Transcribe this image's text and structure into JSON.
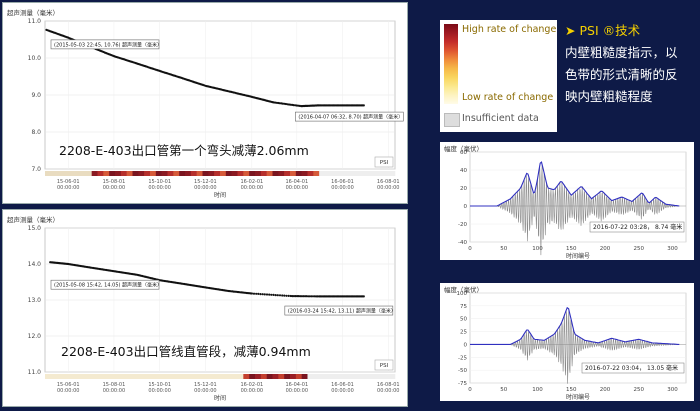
{
  "chart_data": [
    {
      "type": "scatter",
      "ylabel": "超声测量（毫米）",
      "xlabel": "时间",
      "ylim": [
        7.0,
        11.0
      ],
      "yticks": [
        "11.0",
        "10.0",
        "9.0",
        "8.0",
        "7.0"
      ],
      "xticks": [
        "15-06-01\n00:00:00",
        "15-08-01\n00:00:00",
        "15-10-01\n00:00:00",
        "15-12-01\n00:00:00",
        "16-02-01\n00:00:00",
        "16-04-01\n00:00:00",
        "16-06-01\n00:00:00",
        "16-08-01\n00:00:00"
      ],
      "annotations": [
        "(2015-05-03 22:45, 10.76) 超声测量（毫米）",
        "(2016-04-07 06:32, 8.70) 超声测量（毫米）"
      ],
      "caption": "2208-E-403出口管第一个弯头减薄2.06mm",
      "badge": "PSI",
      "x": [
        "2015-05-03",
        "2015-06-01",
        "2015-07-01",
        "2015-08-01",
        "2015-09-01",
        "2015-10-01",
        "2015-11-01",
        "2015-12-01",
        "2016-01-01",
        "2016-02-01",
        "2016-03-01",
        "2016-04-07",
        "2016-05-01",
        "2016-06-01",
        "2016-07-01"
      ],
      "y": [
        10.76,
        10.55,
        10.3,
        10.05,
        9.85,
        9.65,
        9.45,
        9.25,
        9.1,
        8.95,
        8.8,
        8.7,
        8.72,
        8.72,
        8.72
      ]
    },
    {
      "type": "scatter",
      "ylabel": "超声测量（毫米）",
      "xlabel": "时间",
      "ylim": [
        11.0,
        15.0
      ],
      "yticks": [
        "15.0",
        "14.0",
        "13.0",
        "12.0",
        "11.0"
      ],
      "xticks": [
        "15-06-01\n00:00:00",
        "15-08-01\n00:00:00",
        "15-10-01\n00:00:00",
        "15-12-01\n00:00:00",
        "16-02-01\n00:00:00",
        "16-04-01\n00:00:00",
        "16-06-01\n00:00:00",
        "16-08-01\n00:00:00"
      ],
      "annotations": [
        "(2015-05-08 15:42, 14.05) 超声测量（毫米）",
        "(2016-03-24 15:42, 13.11) 超声测量（毫米）"
      ],
      "caption": "2208-E-403出口管线直管段，减薄0.94mm",
      "badge": "PSI",
      "x": [
        "2015-05-08",
        "2015-06-01",
        "2015-07-01",
        "2015-08-01",
        "2015-09-01",
        "2015-10-01",
        "2015-11-01",
        "2015-12-01",
        "2016-01-01",
        "2016-02-01",
        "2016-03-24",
        "2016-05-01",
        "2016-06-01",
        "2016-07-01"
      ],
      "y": [
        14.05,
        14.0,
        13.9,
        13.8,
        13.7,
        13.55,
        13.45,
        13.35,
        13.25,
        13.18,
        13.11,
        13.1,
        13.1,
        13.1
      ]
    },
    {
      "type": "line",
      "ylabel": "幅度（毫伏）",
      "xlabel": "时间编号",
      "ylim": [
        -40,
        60
      ],
      "yticks": [
        "60",
        "40",
        "20",
        "0",
        "-20",
        "-40"
      ],
      "xticks": [
        "0",
        "50",
        "100",
        "150",
        "200",
        "250",
        "300"
      ],
      "annotation": "2016-07-22 03:28， 8.74 毫米",
      "series": [
        {
          "envelope_x": [
            0,
            40,
            60,
            75,
            85,
            95,
            100,
            105,
            115,
            125,
            135,
            150,
            165,
            180,
            195,
            210,
            225,
            240,
            255,
            265,
            275,
            290,
            310
          ],
          "envelope_y": [
            0,
            0,
            8,
            20,
            38,
            12,
            30,
            52,
            20,
            18,
            28,
            12,
            22,
            8,
            17,
            6,
            10,
            5,
            15,
            3,
            10,
            2,
            0
          ]
        }
      ]
    },
    {
      "type": "line",
      "ylabel": "幅度（毫伏）",
      "xlabel": "时间编号",
      "ylim": [
        -75,
        100
      ],
      "yticks": [
        "100",
        "75",
        "50",
        "25",
        "0",
        "-25",
        "-50",
        "-75"
      ],
      "xticks": [
        "0",
        "50",
        "100",
        "150",
        "200",
        "250",
        "300"
      ],
      "annotation": "2016-07-22 03:04， 13.05 毫米",
      "series": [
        {
          "envelope_x": [
            0,
            60,
            75,
            85,
            95,
            110,
            125,
            135,
            145,
            155,
            170,
            190,
            210,
            230,
            250,
            270,
            310
          ],
          "envelope_y": [
            0,
            0,
            10,
            30,
            10,
            8,
            20,
            40,
            75,
            20,
            8,
            3,
            12,
            5,
            10,
            3,
            0
          ]
        }
      ]
    }
  ],
  "legend": {
    "high_label": "High rate of change",
    "low_label": "Low rate of change",
    "insufficient_label": "Insufficient data",
    "gradient_colors": [
      "#7a0a16",
      "#a01a22",
      "#c42d2a",
      "#df5530",
      "#ef8a3a",
      "#f6b848",
      "#f9d55e",
      "#fbe88c",
      "#fdf3c0",
      "#fffbe8"
    ]
  },
  "psi_info": {
    "bullet": "➤",
    "title": "PSI ®技术",
    "lines": [
      "内壁粗糙度指示，以",
      "色带的形式清晰的反",
      "映内壁粗糙程度"
    ]
  }
}
